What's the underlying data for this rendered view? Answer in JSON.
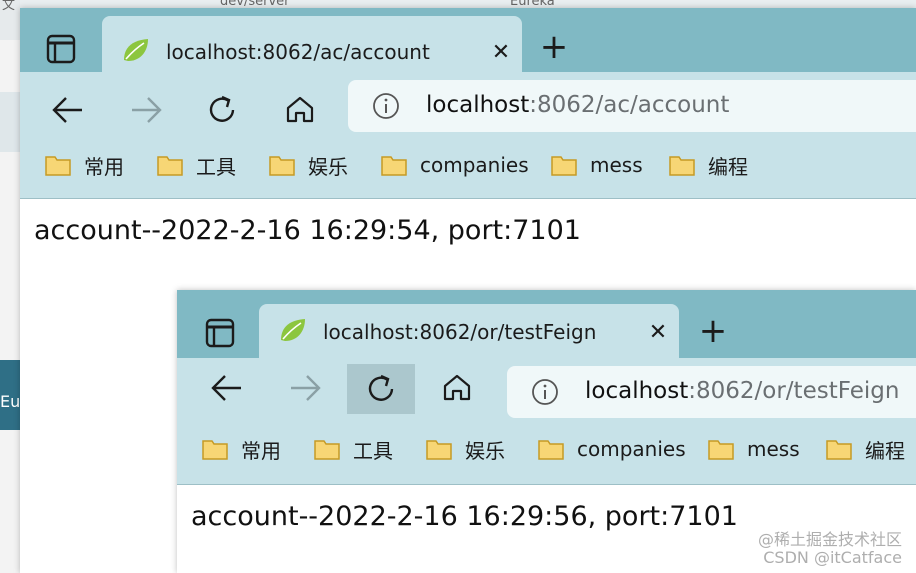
{
  "background": {
    "side_text": "Eu",
    "top_fragments": [
      "文",
      "dev/server",
      "Eureka"
    ]
  },
  "window1": {
    "tab_title": "localhost:8062/ac/account",
    "url_host": "localhost",
    "url_path": ":8062/ac/account",
    "page_text": "account--2022-2-16 16:29:54, port:7101"
  },
  "window2": {
    "tab_title": "localhost:8062/or/testFeign",
    "url_host": "localhost",
    "url_path": ":8062/or/testFeign",
    "page_text": "account--2022-2-16 16:29:56, port:7101"
  },
  "bookmarks": [
    {
      "label": "常用",
      "icon": "folder-icon"
    },
    {
      "label": "工具",
      "icon": "folder-icon"
    },
    {
      "label": "娱乐",
      "icon": "folder-icon"
    },
    {
      "label": "companies",
      "icon": "folder-icon"
    },
    {
      "label": "mess",
      "icon": "folder-icon"
    },
    {
      "label": "编程",
      "icon": "folder-icon"
    }
  ],
  "icons": {
    "tab_close": "close-icon",
    "new_tab": "plus-icon",
    "back": "arrow-left-icon",
    "forward": "arrow-right-icon",
    "reload": "reload-icon",
    "home": "home-icon",
    "site_info": "info-icon",
    "favicon": "leaf-icon",
    "tab_actions": "tab-strip-icon"
  },
  "watermark": {
    "line1": "@稀土掘金技术社区",
    "line2": "CSDN @itCatface"
  },
  "colors": {
    "tab_bar": "#80b9c4",
    "toolbar": "#c7e2e8",
    "address_bar": "#f0f8f9",
    "folder_fill": "#f7d675",
    "folder_stroke": "#c69a24",
    "favicon_green": "#8cc63f"
  }
}
